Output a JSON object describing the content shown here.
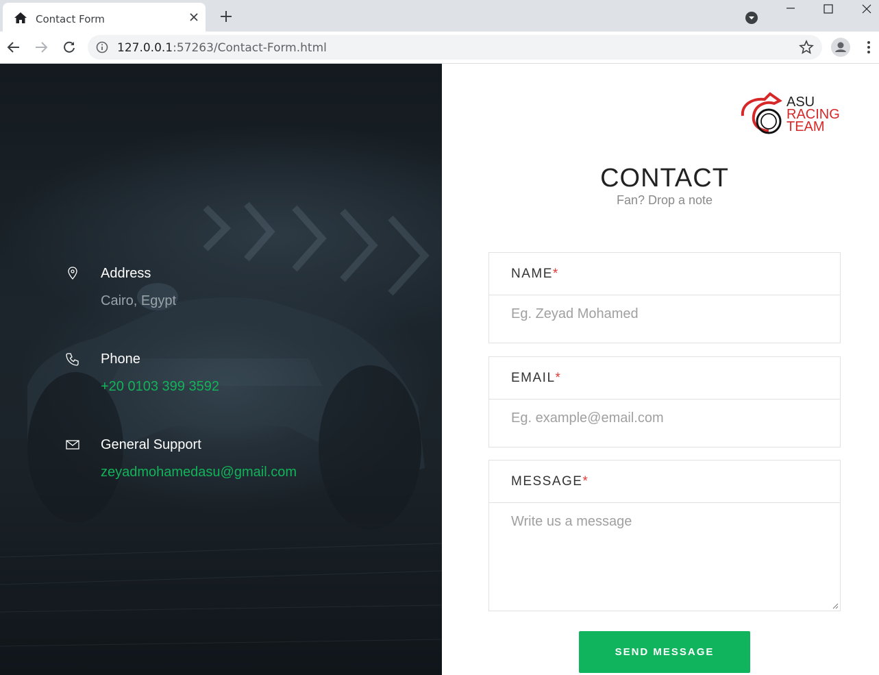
{
  "browser": {
    "tab_title": "Contact Form",
    "url_host": "127.0.0.1",
    "url_rest": ":57263/Contact-Form.html"
  },
  "contact_info": [
    {
      "label": "Address",
      "value": "Cairo, Egypt",
      "icon": "map-pin-icon"
    },
    {
      "label": "Phone",
      "value": "+20 0103 399 3592",
      "icon": "phone-icon"
    },
    {
      "label": "General Support",
      "value": "zeyadmohamedasu@gmail.com",
      "icon": "mail-icon"
    }
  ],
  "logo": {
    "line1": "ASU",
    "line2": "RACING",
    "line3": "TEAM"
  },
  "header": {
    "title": "CONTACT",
    "subtitle": "Fan? Drop a note"
  },
  "form": {
    "name_label": "NAME",
    "name_placeholder": "Eg. Zeyad Mohamed",
    "email_label": "EMAIL",
    "email_placeholder": "Eg. example@email.com",
    "message_label": "MESSAGE",
    "message_placeholder": "Write us a message",
    "required_mark": "*",
    "submit_label": "SEND MESSAGE"
  },
  "colors": {
    "accent": "#10b45c",
    "required": "#e53935",
    "logo_red": "#d62828"
  }
}
